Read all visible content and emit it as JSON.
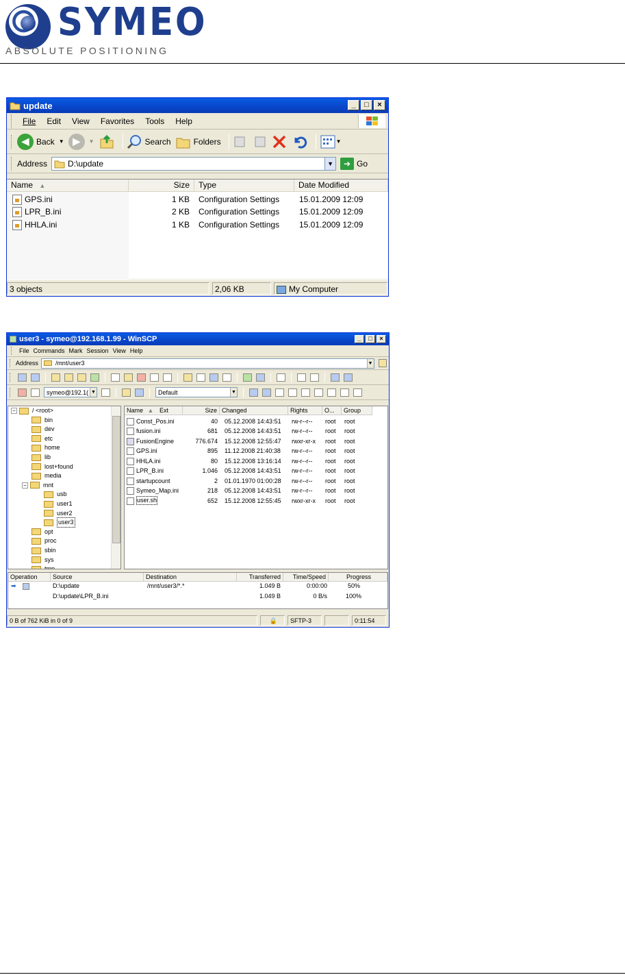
{
  "brand": {
    "name": "SYMEO",
    "tagline": "ABSOLUTE POSITIONING"
  },
  "explorer": {
    "title": "update",
    "menu": [
      "File",
      "Edit",
      "View",
      "Favorites",
      "Tools",
      "Help"
    ],
    "toolbar": {
      "back": "Back",
      "search": "Search",
      "folders": "Folders"
    },
    "address_label": "Address",
    "address_value": "D:\\update",
    "go_label": "Go",
    "columns": {
      "name": "Name",
      "size": "Size",
      "type": "Type",
      "modified": "Date Modified"
    },
    "files": [
      {
        "name": "GPS.ini",
        "size": "1 KB",
        "type": "Configuration Settings",
        "modified": "15.01.2009 12:09"
      },
      {
        "name": "LPR_B.ini",
        "size": "2 KB",
        "type": "Configuration Settings",
        "modified": "15.01.2009 12:09"
      },
      {
        "name": "HHLA.ini",
        "size": "1 KB",
        "type": "Configuration Settings",
        "modified": "15.01.2009 12:09"
      }
    ],
    "status": {
      "objects": "3 objects",
      "size": "2,06 KB",
      "location": "My Computer"
    }
  },
  "winscp": {
    "title": "user3 - symeo@192.168.1.99 - WinSCP",
    "menu": [
      "File",
      "Commands",
      "Mark",
      "Session",
      "View",
      "Help"
    ],
    "address_label": "Address",
    "address_value": "/mnt/user3",
    "session_value": "symeo@192.1(",
    "preset_value": "Default",
    "tree": [
      {
        "label": "/ <root>",
        "depth": 0,
        "expanded": true
      },
      {
        "label": "bin",
        "depth": 1
      },
      {
        "label": "dev",
        "depth": 1
      },
      {
        "label": "etc",
        "depth": 1
      },
      {
        "label": "home",
        "depth": 1
      },
      {
        "label": "lib",
        "depth": 1
      },
      {
        "label": "lost+found",
        "depth": 1
      },
      {
        "label": "media",
        "depth": 1
      },
      {
        "label": "mnt",
        "depth": 1,
        "expanded": true
      },
      {
        "label": "usb",
        "depth": 2
      },
      {
        "label": "user1",
        "depth": 2
      },
      {
        "label": "user2",
        "depth": 2
      },
      {
        "label": "user3",
        "depth": 2,
        "selected": true
      },
      {
        "label": "opt",
        "depth": 1
      },
      {
        "label": "proc",
        "depth": 1
      },
      {
        "label": "sbin",
        "depth": 1
      },
      {
        "label": "sys",
        "depth": 1
      },
      {
        "label": "tmp",
        "depth": 1
      }
    ],
    "columns": {
      "name": "Name",
      "ext": "Ext",
      "size": "Size",
      "changed": "Changed",
      "rights": "Rights",
      "owner": "O...",
      "group": "Group"
    },
    "files": [
      {
        "name": "Const_Pos.ini",
        "size": "40",
        "changed": "05.12.2008 14:43:51",
        "rights": "rw-r--r--",
        "owner": "root",
        "group": "root"
      },
      {
        "name": "fusion.ini",
        "size": "681",
        "changed": "05.12.2008 14:43:51",
        "rights": "rw-r--r--",
        "owner": "root",
        "group": "root"
      },
      {
        "name": "FusionEngine",
        "size": "776.674",
        "changed": "15.12.2008 12:55:47",
        "rights": "rwxr-xr-x",
        "owner": "root",
        "group": "root"
      },
      {
        "name": "GPS.ini",
        "size": "895",
        "changed": "11.12.2008 21:40:38",
        "rights": "rw-r--r--",
        "owner": "root",
        "group": "root"
      },
      {
        "name": "HHLA.ini",
        "size": "80",
        "changed": "15.12.2008 13:16:14",
        "rights": "rw-r--r--",
        "owner": "root",
        "group": "root"
      },
      {
        "name": "LPR_B.ini",
        "size": "1.046",
        "changed": "05.12.2008 14:43:51",
        "rights": "rw-r--r--",
        "owner": "root",
        "group": "root"
      },
      {
        "name": "startupcount",
        "size": "2",
        "changed": "01.01.1970 01:00:28",
        "rights": "rw-r--r--",
        "owner": "root",
        "group": "root"
      },
      {
        "name": "Symeo_Map.ini",
        "size": "218",
        "changed": "05.12.2008 14:43:51",
        "rights": "rw-r--r--",
        "owner": "root",
        "group": "root"
      },
      {
        "name": "user.sh",
        "size": "652",
        "changed": "15.12.2008 12:55:45",
        "rights": "rwxr-xr-x",
        "owner": "root",
        "group": "root"
      }
    ],
    "queue_columns": {
      "operation": "Operation",
      "source": "Source",
      "destination": "Destination",
      "transferred": "Transferred",
      "time_speed": "Time/Speed",
      "progress": "Progress"
    },
    "queue": [
      {
        "source": "D:\\update",
        "destination": "/mnt/user3/*.*",
        "transferred": "1.049 B",
        "time_speed": "0:00:00",
        "progress": "50%"
      },
      {
        "source": "D:\\update\\LPR_B.ini",
        "destination": "",
        "transferred": "1.049 B",
        "time_speed": "0 B/s",
        "progress": "100%"
      }
    ],
    "status": {
      "summary": "0 B of 762 KiB in 0 of 9",
      "protocol": "SFTP-3",
      "elapsed": "0:11:54"
    }
  }
}
